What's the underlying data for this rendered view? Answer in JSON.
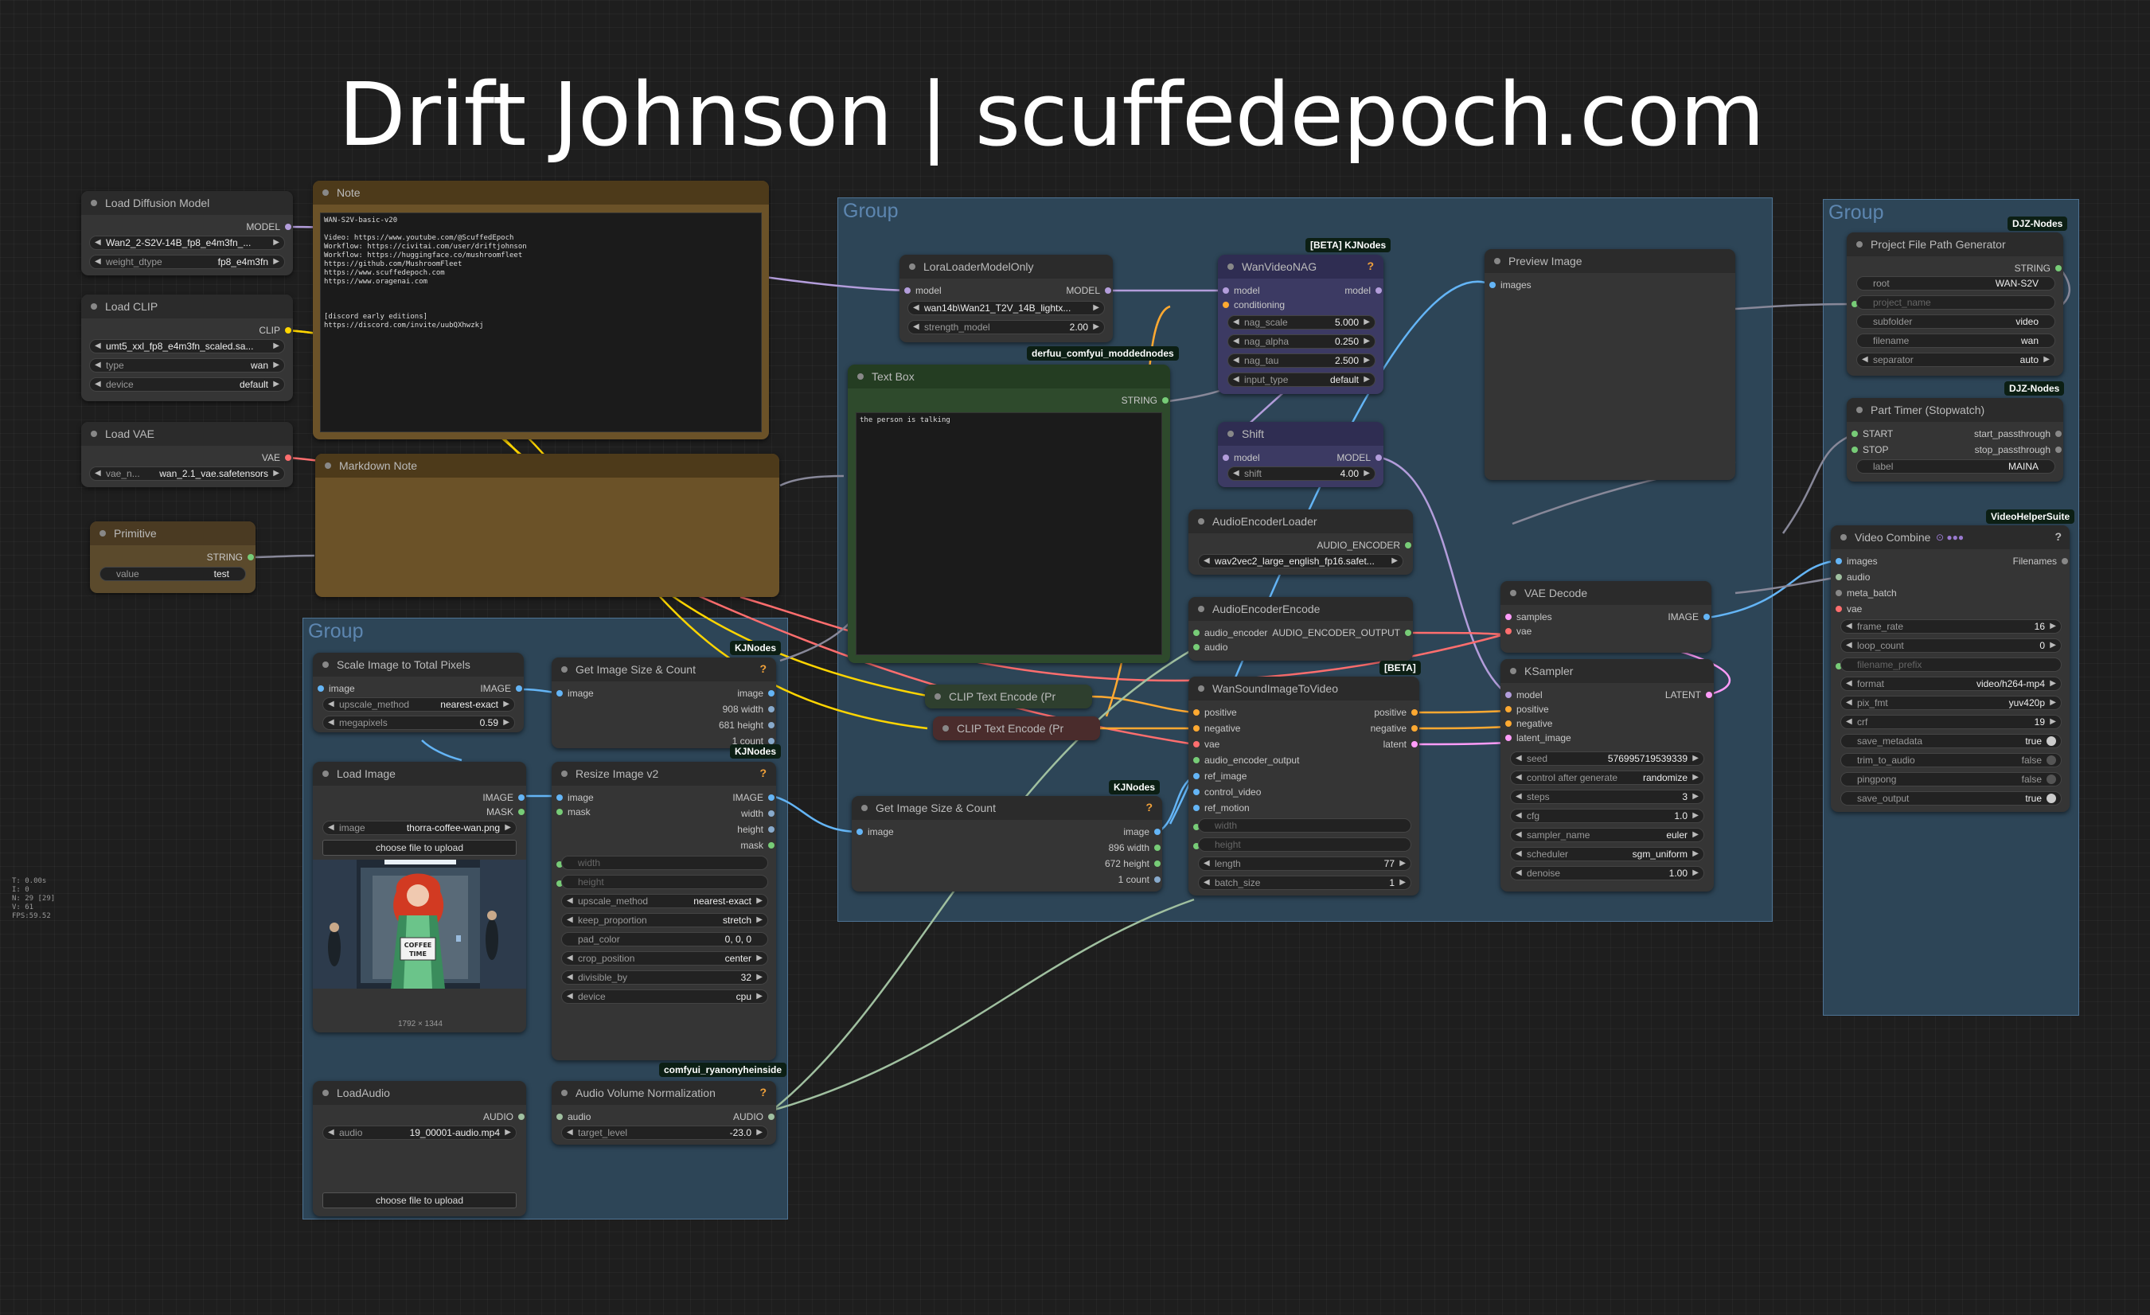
{
  "title": "Drift Johnson | scuffedepoch.com",
  "groups": [
    "Group",
    "Group",
    "Group"
  ],
  "badges": {
    "kj1": "[BETA] KJNodes",
    "derfuu": "derfuu_comfyui_moddednodes",
    "kj2": "KJNodes",
    "kj3": "KJNodes",
    "kj4": "KJNodes",
    "ryan": "comfyui_ryanonyheinside",
    "beta": "[BETA]",
    "djz1": "DJZ-Nodes",
    "djz2": "DJZ-Nodes",
    "vhs": "VideoHelperSuite"
  },
  "stats": [
    "T: 0.00s",
    "I: 0",
    "N: 29 [29]",
    "V: 61",
    "FPS:59.52"
  ],
  "load_diffusion": {
    "title": "Load Diffusion Model",
    "out": "MODEL",
    "unet_name": "Wan2_2-S2V-14B_fp8_e4m3fn_...",
    "weight_dtype_k": "weight_dtype",
    "weight_dtype_v": "fp8_e4m3fn"
  },
  "load_clip": {
    "title": "Load CLIP",
    "out": "CLIP",
    "clip_name": "umt5_xxl_fp8_e4m3fn_scaled.sa...",
    "type_k": "type",
    "type_v": "wan",
    "device_k": "device",
    "device_v": "default"
  },
  "load_vae": {
    "title": "Load VAE",
    "out": "VAE",
    "k": "vae_n...",
    "v": "wan_2.1_vae.safetensors"
  },
  "primitive": {
    "title": "Primitive",
    "out": "STRING",
    "k": "value",
    "v": "test"
  },
  "note": {
    "title": "Note",
    "text": "WAN-S2V-basic-v20\n\nVideo: https://www.youtube.com/@ScuffedEpoch\nWorkflow: https://civitai.com/user/driftjohnson\nWorkflow: https://huggingface.co/mushroomfleet\nhttps://github.com/MushroomFleet\nhttps://www.scuffedepoch.com\nhttps://www.oragenai.com\n\n\n\n[discord early editions]\nhttps://discord.com/invite/uubQXhwzkj"
  },
  "markdown": {
    "title": "Markdown Note"
  },
  "lora": {
    "title": "LoraLoaderModelOnly",
    "in": "model",
    "out": "MODEL",
    "name": "wan14b\\Wan21_T2V_14B_lightx...",
    "strength_k": "strength_model",
    "strength_v": "2.00"
  },
  "textbox": {
    "title": "Text Box",
    "out": "STRING",
    "text": "the person is talking"
  },
  "nag": {
    "title": "WanVideoNAG",
    "in1": "model",
    "in2": "conditioning",
    "out": "model",
    "scale_k": "nag_scale",
    "scale_v": "5.000",
    "alpha_k": "nag_alpha",
    "alpha_v": "0.250",
    "tau_k": "nag_tau",
    "tau_v": "2.500",
    "it_k": "input_type",
    "it_v": "default"
  },
  "shift": {
    "title": "Shift",
    "in": "model",
    "out": "MODEL",
    "k": "shift",
    "v": "4.00"
  },
  "preview": {
    "title": "Preview Image",
    "in": "images"
  },
  "aenc_loader": {
    "title": "AudioEncoderLoader",
    "out": "AUDIO_ENCODER",
    "v": "wav2vec2_large_english_fp16.safet..."
  },
  "aenc_encode": {
    "title": "AudioEncoderEncode",
    "in1": "audio_encoder",
    "in2": "audio",
    "out": "AUDIO_ENCODER_OUTPUT"
  },
  "clip1": {
    "title": "CLIP Text Encode (Pr"
  },
  "clip2": {
    "title": "CLIP Text Encode (Pr"
  },
  "vae_decode": {
    "title": "VAE Decode",
    "in1": "samples",
    "in2": "vae",
    "out": "IMAGE"
  },
  "ksampler": {
    "title": "KSampler",
    "ins": [
      "model",
      "positive",
      "negative",
      "latent_image"
    ],
    "out": "LATENT",
    "seed_k": "seed",
    "seed_v": "576995719539339",
    "cag_k": "control after generate",
    "cag_v": "randomize",
    "steps_k": "steps",
    "steps_v": "3",
    "cfg_k": "cfg",
    "cfg_v": "1.0",
    "sampler_k": "sampler_name",
    "sampler_v": "euler",
    "sched_k": "scheduler",
    "sched_v": "sgm_uniform",
    "den_k": "denoise",
    "den_v": "1.00"
  },
  "wsi": {
    "title": "WanSoundImageToVideo",
    "ins": [
      "positive",
      "negative",
      "vae",
      "audio_encoder_output",
      "ref_image",
      "control_video",
      "ref_motion"
    ],
    "outs": [
      "positive",
      "negative",
      "latent"
    ],
    "width_k": "width",
    "height_k": "height",
    "len_k": "length",
    "len_v": "77",
    "bs_k": "batch_size",
    "bs_v": "1"
  },
  "scale": {
    "title": "Scale Image to Total Pixels",
    "in": "image",
    "out": "IMAGE",
    "um_k": "upscale_method",
    "um_v": "nearest-exact",
    "mp_k": "megapixels",
    "mp_v": "0.59"
  },
  "gis1": {
    "title": "Get Image Size & Count",
    "in": "image",
    "outs": [
      "image",
      "908 width",
      "681 height",
      "1 count"
    ]
  },
  "load_image": {
    "title": "Load Image",
    "outs": [
      "IMAGE",
      "MASK"
    ],
    "k": "image",
    "v": "thorra-coffee-wan.png",
    "upload": "choose file to upload",
    "dims": "1792 × 1344",
    "sign": "COFFEE TIME"
  },
  "resize": {
    "title": "Resize Image v2",
    "ins": [
      "image",
      "mask"
    ],
    "outs": [
      "IMAGE",
      "width",
      "height",
      "mask"
    ],
    "w_k": "width",
    "h_k": "height",
    "um_k": "upscale_method",
    "um_v": "nearest-exact",
    "kp_k": "keep_proportion",
    "kp_v": "stretch",
    "pc_k": "pad_color",
    "pc_v": "0, 0, 0",
    "cp_k": "crop_position",
    "cp_v": "center",
    "db_k": "divisible_by",
    "db_v": "32",
    "dev_k": "device",
    "dev_v": "cpu"
  },
  "gis2": {
    "title": "Get Image Size & Count",
    "in": "image",
    "outs": [
      "image",
      "896 width",
      "672 height",
      "1 count"
    ]
  },
  "load_audio": {
    "title": "LoadAudio",
    "out": "AUDIO",
    "k": "audio",
    "v": "19_00001-audio.mp4",
    "upload": "choose file to upload"
  },
  "avn": {
    "title": "Audio Volume Normalization",
    "in": "audio",
    "out": "AUDIO",
    "k": "target_level",
    "v": "-23.0"
  },
  "pfpg": {
    "title": "Project File Path Generator",
    "out": "STRING",
    "root_k": "root",
    "root_v": "WAN-S2V",
    "pn_k": "project_name",
    "sub_k": "subfolder",
    "sub_v": "video",
    "fn_k": "filename",
    "fn_v": "wan",
    "sep_k": "separator",
    "sep_v": "auto"
  },
  "timer": {
    "title": "Part Timer (Stopwatch)",
    "in1": "START",
    "in2": "STOP",
    "out1": "start_passthrough",
    "out2": "stop_passthrough",
    "k": "label",
    "v": "MAINA"
  },
  "vcombine": {
    "title": "Video Combine",
    "ins": [
      "images",
      "audio",
      "meta_batch",
      "vae"
    ],
    "out": "Filenames",
    "fr_k": "frame_rate",
    "fr_v": "16",
    "lc_k": "loop_count",
    "lc_v": "0",
    "fp_k": "filename_prefix",
    "fmt_k": "format",
    "fmt_v": "video/h264-mp4",
    "pix_k": "pix_fmt",
    "pix_v": "yuv420p",
    "crf_k": "crf",
    "crf_v": "19",
    "sm_k": "save_metadata",
    "sm_v": "true",
    "tta_k": "trim_to_audio",
    "tta_v": "false",
    "pp_k": "pingpong",
    "pp_v": "false",
    "so_k": "save_output",
    "so_v": "true"
  },
  "colors": {
    "model": "#b39ddb",
    "clip": "#ffd500",
    "vae": "#ff6e6e",
    "image": "#64b5f6",
    "conditioning": "#ffa931",
    "latent": "#ff9cf9",
    "string": "#77cc77",
    "audio": "#a0c0a0"
  }
}
